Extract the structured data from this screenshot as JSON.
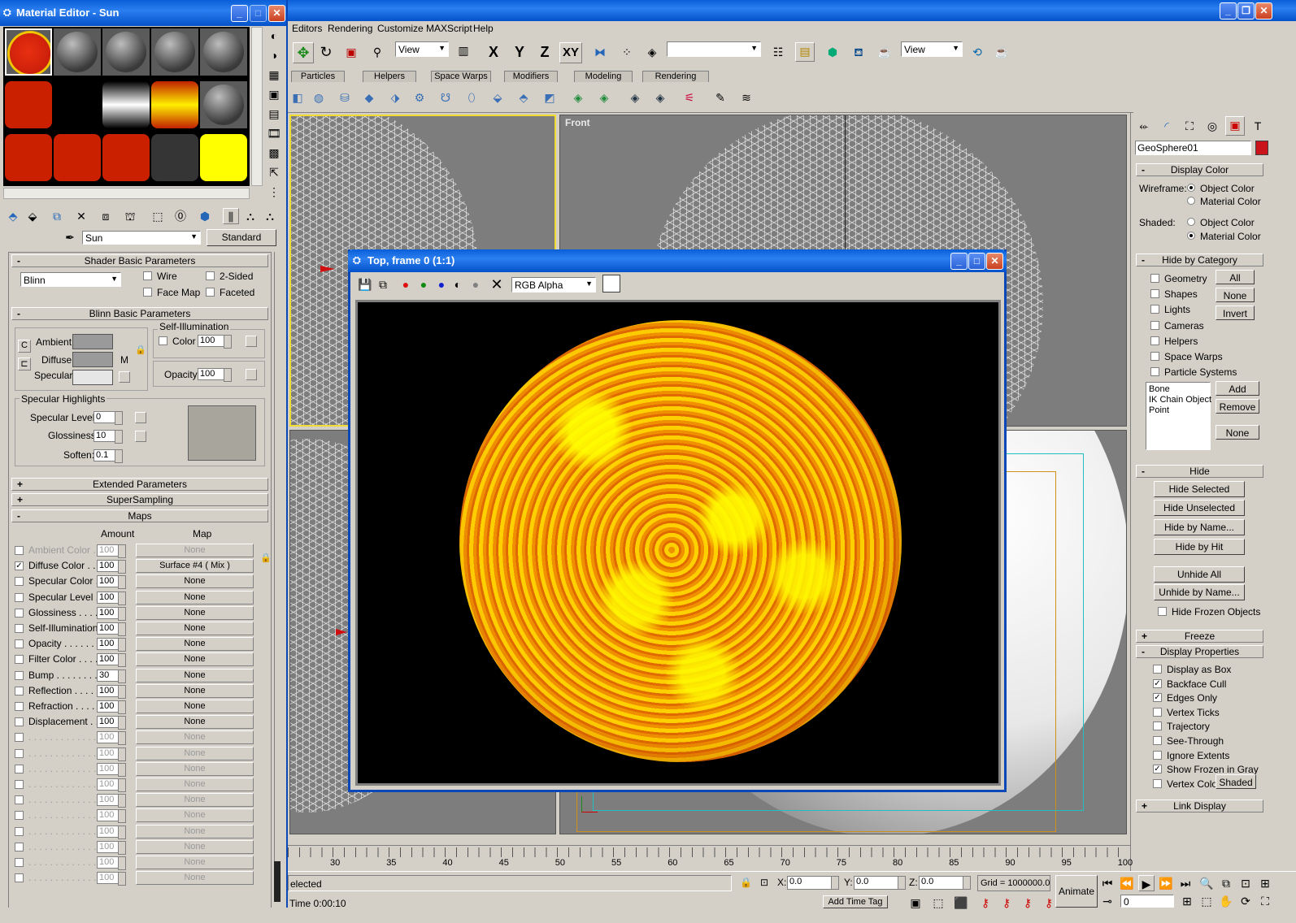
{
  "material_editor": {
    "title": "Material Editor - Sun",
    "material_name": "Sun",
    "material_type": "Standard",
    "shader_rollout": "Shader Basic Parameters",
    "shader": "Blinn",
    "wire": "Wire",
    "two_sided": "2-Sided",
    "face_map": "Face Map",
    "faceted": "Faceted",
    "blinn_rollout": "Blinn Basic Parameters",
    "self_illum_group": "Self-Illumination",
    "color_label": "Color",
    "self_illum_value": "100",
    "ambient": "Ambient:",
    "diffuse": "Diffuse:",
    "specular": "Specular:",
    "m_label": "M",
    "opacity_label": "Opacity:",
    "opacity_value": "100",
    "spec_highlights": "Specular Highlights",
    "spec_level_label": "Specular Level:",
    "spec_level": "0",
    "glossiness_label": "Glossiness:",
    "glossiness": "10",
    "soften_label": "Soften:",
    "soften": "0.1",
    "extended": "Extended Parameters",
    "supersampling": "SuperSampling",
    "maps": "Maps",
    "amount_header": "Amount",
    "map_header": "Map",
    "map_rows": [
      {
        "name": "Ambient Color . .",
        "amount": "100",
        "map": "None",
        "checked": false,
        "dim": true
      },
      {
        "name": "Diffuse Color . .",
        "amount": "100",
        "map": "Surface #4  ( Mix )",
        "checked": true,
        "dim": false
      },
      {
        "name": "Specular Color  .",
        "amount": "100",
        "map": "None",
        "checked": false,
        "dim": false
      },
      {
        "name": "Specular Level  .",
        "amount": "100",
        "map": "None",
        "checked": false,
        "dim": false
      },
      {
        "name": "Glossiness  . . . .",
        "amount": "100",
        "map": "None",
        "checked": false,
        "dim": false
      },
      {
        "name": "Self-Illumination .",
        "amount": "100",
        "map": "None",
        "checked": false,
        "dim": false
      },
      {
        "name": "Opacity . . . . . . .",
        "amount": "100",
        "map": "None",
        "checked": false,
        "dim": false
      },
      {
        "name": "Filter Color  . . . .",
        "amount": "100",
        "map": "None",
        "checked": false,
        "dim": false
      },
      {
        "name": "Bump  . . . . . . . .",
        "amount": "30",
        "map": "None",
        "checked": false,
        "dim": false
      },
      {
        "name": "Reflection  . . . . .",
        "amount": "100",
        "map": "None",
        "checked": false,
        "dim": false
      },
      {
        "name": "Refraction  . . . . .",
        "amount": "100",
        "map": "None",
        "checked": false,
        "dim": false
      },
      {
        "name": "Displacement  . . .",
        "amount": "100",
        "map": "None",
        "checked": false,
        "dim": false
      },
      {
        "name": ". . . . . . . . . . . . .",
        "amount": "100",
        "map": "None",
        "checked": false,
        "dim": true
      },
      {
        "name": ". . . . . . . . . . . . .",
        "amount": "100",
        "map": "None",
        "checked": false,
        "dim": true
      },
      {
        "name": ". . . . . . . . . . . . .",
        "amount": "100",
        "map": "None",
        "checked": false,
        "dim": true
      },
      {
        "name": ". . . . . . . . . . . . .",
        "amount": "100",
        "map": "None",
        "checked": false,
        "dim": true
      },
      {
        "name": ". . . . . . . . . . . . .",
        "amount": "100",
        "map": "None",
        "checked": false,
        "dim": true
      },
      {
        "name": ". . . . . . . . . . . . .",
        "amount": "100",
        "map": "None",
        "checked": false,
        "dim": true
      },
      {
        "name": ". . . . . . . . . . . . .",
        "amount": "100",
        "map": "None",
        "checked": false,
        "dim": true
      },
      {
        "name": ". . . . . . . . . . . . .",
        "amount": "100",
        "map": "None",
        "checked": false,
        "dim": true
      },
      {
        "name": ". . . . . . . . . . . . .",
        "amount": "100",
        "map": "None",
        "checked": false,
        "dim": true
      },
      {
        "name": ". . . . . . . . . . . . .",
        "amount": "100",
        "map": "None",
        "checked": false,
        "dim": true
      }
    ]
  },
  "menu": [
    "Editors",
    "Rendering",
    "Customize",
    "MAXScript",
    "Help"
  ],
  "toolbar": {
    "view1": "View",
    "view2": "View",
    "x": "X",
    "y": "Y",
    "z": "Z",
    "xy": "XY"
  },
  "tabs": [
    "Particles",
    "Helpers",
    "Space Warps",
    "Modifiers",
    "Modeling",
    "Rendering"
  ],
  "viewport_front_label": "Front",
  "render_window": {
    "title": "Top, frame 0 (1:1)",
    "channel": "RGB Alpha"
  },
  "command_panel": {
    "object_name": "GeoSphere01",
    "object_color": "#c8141a",
    "display_color": "Display Color",
    "wireframe_label": "Wireframe:",
    "shaded_label": "Shaded:",
    "object_color_opt": "Object Color",
    "material_color_opt": "Material Color",
    "hide_by_category": "Hide by Category",
    "categories": [
      "Geometry",
      "Shapes",
      "Lights",
      "Cameras",
      "Helpers",
      "Space Warps",
      "Particle Systems"
    ],
    "all": "All",
    "none": "None",
    "invert": "Invert",
    "list_items": [
      "Bone",
      "IK Chain Object",
      "Point"
    ],
    "add": "Add",
    "remove": "Remove",
    "none2": "None",
    "hide": "Hide",
    "hide_buttons": [
      "Hide Selected",
      "Hide Unselected",
      "Hide by Name...",
      "Hide by Hit"
    ],
    "unhide_all": "Unhide All",
    "unhide_by_name": "Unhide by Name...",
    "hide_frozen": "Hide Frozen Objects",
    "freeze": "Freeze",
    "display_properties": "Display Properties",
    "props": [
      {
        "label": "Display as Box",
        "checked": false
      },
      {
        "label": "Backface Cull",
        "checked": true
      },
      {
        "label": "Edges Only",
        "checked": true
      },
      {
        "label": "Vertex Ticks",
        "checked": false
      },
      {
        "label": "Trajectory",
        "checked": false
      },
      {
        "label": "See-Through",
        "checked": false
      },
      {
        "label": "Ignore Extents",
        "checked": false
      },
      {
        "label": "Show Frozen in Gray",
        "checked": true
      },
      {
        "label": "Vertex Colors",
        "checked": false
      }
    ],
    "shaded_btn": "Shaded",
    "link_display": "Link Display"
  },
  "timeline": {
    "ticks": [
      "30",
      "35",
      "40",
      "45",
      "50",
      "55",
      "60",
      "65",
      "70",
      "75",
      "80",
      "85",
      "90",
      "95",
      "100"
    ]
  },
  "status": {
    "selected": "elected",
    "time": "Time  0:00:10",
    "x_label": "X:",
    "x": "0.0",
    "y_label": "Y:",
    "y": "0.0",
    "z_label": "Z:",
    "z": "0.0",
    "grid": "Grid = 1000000.0",
    "add_time_tag": "Add Time Tag",
    "animate": "Animate",
    "frame": "0"
  }
}
